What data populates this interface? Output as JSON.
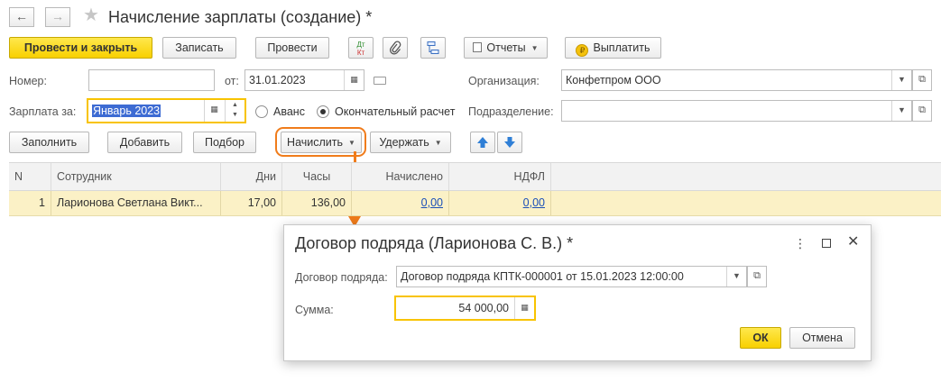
{
  "title_bar": {
    "back_label": "←",
    "forward_label": "→",
    "title": "Начисление зарплаты (создание) *"
  },
  "toolbar": {
    "post_close_label": "Провести и закрыть",
    "save_label": "Записать",
    "post_label": "Провести",
    "dt_kt_label_top": "Дт",
    "dt_kt_label_bottom": "Кт",
    "reports_label": "Отчеты",
    "pay_label": "Выплатить"
  },
  "form": {
    "number_label": "Номер:",
    "number_value": "",
    "date_label": "от:",
    "date_value": "31.01.2023",
    "org_label": "Организация:",
    "org_value": "Конфетпром ООО",
    "salary_for_label": "Зарплата за:",
    "salary_for_value": "Январь 2023",
    "advance_label": "Аванс",
    "final_label": "Окончательный расчет",
    "dept_label": "Подразделение:",
    "dept_value": ""
  },
  "table_toolbar": {
    "fill_label": "Заполнить",
    "add_label": "Добавить",
    "select_label": "Подбор",
    "accrue_label": "Начислить",
    "withhold_label": "Удержать"
  },
  "table": {
    "columns": [
      "N",
      "Сотрудник",
      "Дни",
      "Часы",
      "Начислено",
      "НДФЛ"
    ],
    "rows": [
      {
        "n": "1",
        "employee": "Ларионова Светлана Викт...",
        "days": "17,00",
        "hours": "136,00",
        "accrued": "0,00",
        "ndfl": "0,00"
      }
    ]
  },
  "dialog": {
    "title": "Договор подряда (Ларионова С. В.) *",
    "contract_label": "Договор подряда:",
    "contract_value": "Договор подряда КПТК-000001 от 15.01.2023 12:00:00",
    "sum_label": "Сумма:",
    "sum_value": "54 000,00",
    "ok_label": "ОК",
    "cancel_label": "Отмена"
  },
  "colors": {
    "accent_yellow": "#f8d000",
    "highlight_orange": "#f07c1b",
    "row_selected": "#fbf1c6",
    "link_blue": "#1a4fb8"
  }
}
